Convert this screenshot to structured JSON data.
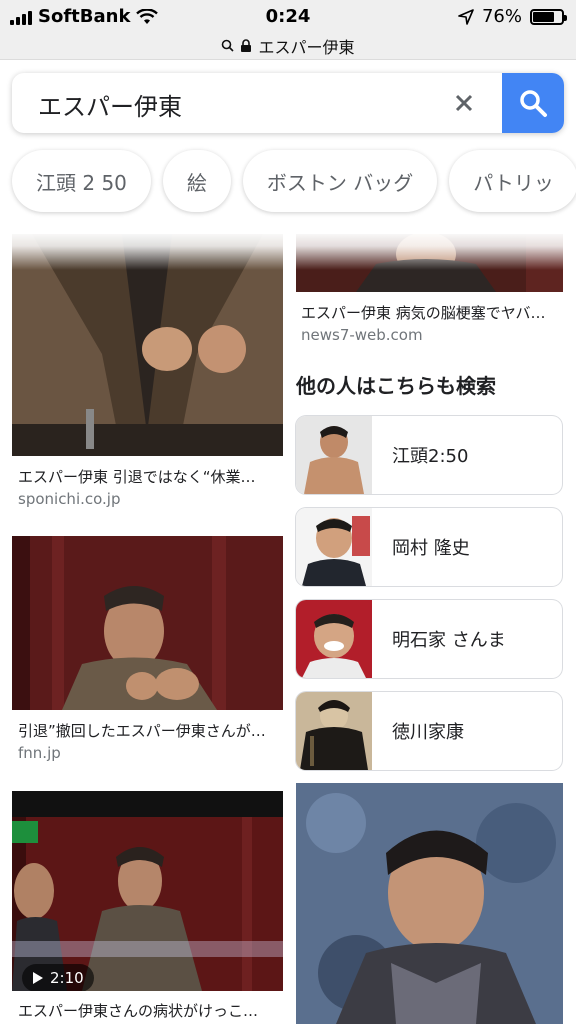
{
  "status_bar": {
    "carrier": "SoftBank",
    "time": "0:24",
    "battery": "76%",
    "battery_level": 0.76
  },
  "url_bar": {
    "title": "エスパー伊東"
  },
  "search": {
    "query": "エスパー伊東"
  },
  "chips": [
    "江頭 2 50",
    "絵",
    "ボストン バッグ",
    "パトリッ"
  ],
  "results": [
    {
      "caption": "エスパー伊東 病気の脳梗塞でヤバ…",
      "source": "news7-web.com"
    },
    {
      "caption": "エスパー伊東 引退ではなく“休業…",
      "source": "sponichi.co.jp"
    },
    {
      "caption": "引退”撤回したエスパー伊東さんが…",
      "source": "fnn.jp"
    },
    {
      "caption": "エスパー伊東さんの病状がけっこ…",
      "source": ""
    }
  ],
  "related": {
    "title": "他の人はこちらも検索",
    "items": [
      "江頭2:50",
      "岡村 隆史",
      "明石家 さんま",
      "徳川家康"
    ]
  },
  "video": {
    "duration": "2:10"
  },
  "colors": {
    "accent": "#4285f4",
    "status_bar_bg": "#efefef"
  }
}
